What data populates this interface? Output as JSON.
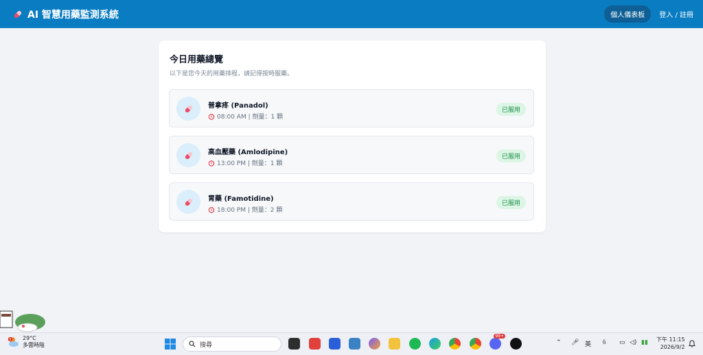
{
  "header": {
    "app_title": "AI 智慧用藥監測系統",
    "dashboard_label": "個人儀表板",
    "login_label": "登入 / 註冊"
  },
  "overview": {
    "title": "今日用藥總覽",
    "subtitle": "以下是您今天的用藥排程，請記得按時服藥。"
  },
  "medications": [
    {
      "name": "普拿疼 (Panadol)",
      "time": "08:00 AM | 劑量：1 顆",
      "status": "已服用"
    },
    {
      "name": "高血壓藥 (Amlodipine)",
      "time": "13:00 PM | 劑量：1 顆",
      "status": "已服用"
    },
    {
      "name": "胃藥 (Famotidine)",
      "time": "18:00 PM | 劑量：2 顆",
      "status": "已服用"
    }
  ],
  "taskbar": {
    "weather_temp": "29°C",
    "weather_desc": "多雲時陰",
    "weather_badge": "5",
    "search_placeholder": "搜尋",
    "ime_label": "英",
    "clock_period": "下午 11:15",
    "clock_date": "2026/9/2",
    "discord_badge": "99+"
  },
  "colors": {
    "header": "#0a7cc2",
    "accent_badge": "#1d8f4c"
  }
}
